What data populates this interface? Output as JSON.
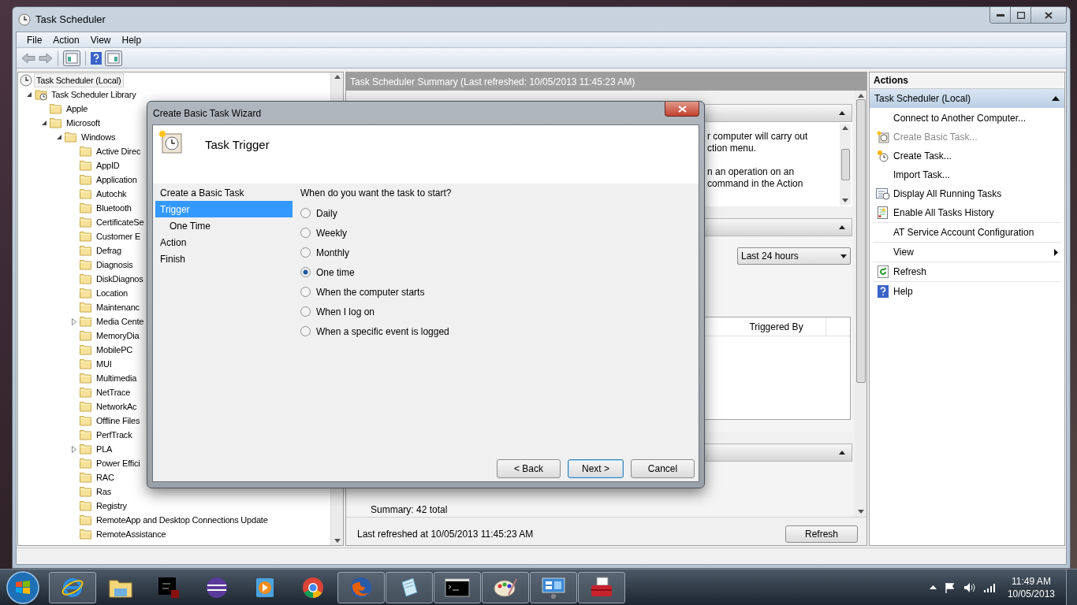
{
  "window": {
    "title": "Task Scheduler"
  },
  "menu": [
    "File",
    "Action",
    "View",
    "Help"
  ],
  "tree": [
    {
      "label": "Task Scheduler (Local)",
      "selected": true,
      "children": [
        {
          "label": "Task Scheduler Library",
          "selected": false,
          "expanded": true,
          "children": [
            {
              "label": "Apple",
              "selected": false
            },
            {
              "label": "Microsoft",
              "selected": false,
              "expanded": true,
              "children": [
                {
                  "label": "Windows",
                  "selected": false,
                  "expanded": true,
                  "children": [
                    {
                      "label": "Active Direc",
                      "selected": false
                    },
                    {
                      "label": "AppID",
                      "selected": false
                    },
                    {
                      "label": "Application",
                      "selected": false
                    },
                    {
                      "label": "Autochk",
                      "selected": false
                    },
                    {
                      "label": "Bluetooth",
                      "selected": false
                    },
                    {
                      "label": "CertificateSe",
                      "selected": false
                    },
                    {
                      "label": "Customer E",
                      "selected": false
                    },
                    {
                      "label": "Defrag",
                      "selected": false
                    },
                    {
                      "label": "Diagnosis",
                      "selected": false
                    },
                    {
                      "label": "DiskDiagnos",
                      "selected": false
                    },
                    {
                      "label": "Location",
                      "selected": false
                    },
                    {
                      "label": "Maintenanc",
                      "selected": false
                    },
                    {
                      "label": "Media Cente",
                      "selected": false,
                      "expanded": false
                    },
                    {
                      "label": "MemoryDia",
                      "selected": false
                    },
                    {
                      "label": "MobilePC",
                      "selected": false
                    },
                    {
                      "label": "MUI",
                      "selected": false
                    },
                    {
                      "label": "Multimedia",
                      "selected": false
                    },
                    {
                      "label": "NetTrace",
                      "selected": false
                    },
                    {
                      "label": "NetworkAc",
                      "selected": false
                    },
                    {
                      "label": "Offline Files",
                      "selected": false
                    },
                    {
                      "label": "PerfTrack",
                      "selected": false
                    },
                    {
                      "label": "PLA",
                      "selected": false,
                      "expanded": false
                    },
                    {
                      "label": "Power Effici",
                      "selected": false
                    },
                    {
                      "label": "RAC",
                      "selected": false
                    },
                    {
                      "label": "Ras",
                      "selected": false
                    },
                    {
                      "label": "Registry",
                      "selected": false
                    },
                    {
                      "label": "RemoteApp and Desktop Connections Update",
                      "selected": false
                    },
                    {
                      "label": "RemoteAssistance",
                      "selected": false
                    }
                  ]
                }
              ]
            }
          ]
        }
      ]
    }
  ],
  "summary": {
    "title": "Task Scheduler Summary (Last refreshed: 10/05/2013 11:45:23 AM)",
    "sections": [
      {
        "expanded": true
      },
      {
        "expanded": true
      },
      {
        "expanded": true
      }
    ],
    "overview_lines": [
      "r computer will carry out",
      "ction menu.",
      "n an operation on an",
      "command in the Action"
    ],
    "status_filter": "Last 24 hours",
    "table_columns": [
      "Triggered By"
    ],
    "summary_text": "Summary: 42 total",
    "last_refreshed": "Last refreshed at 10/05/2013 11:45:23 AM",
    "refresh_button": "Refresh"
  },
  "actions": {
    "title": "Actions",
    "group": {
      "label": "Task Scheduler (Local)",
      "expanded": true
    },
    "groups": [
      [
        {
          "label": "Connect to Another Computer...",
          "disabled": false,
          "submenu": false
        },
        {
          "label": "Create Basic Task...",
          "disabled": true,
          "submenu": false
        },
        {
          "label": "Create Task...",
          "disabled": false,
          "submenu": false
        },
        {
          "label": "Import Task...",
          "disabled": false,
          "submenu": false
        },
        {
          "label": "Display All Running Tasks",
          "disabled": false,
          "submenu": false
        },
        {
          "label": "Enable All Tasks History",
          "disabled": false,
          "submenu": false
        }
      ],
      [
        {
          "label": "AT Service Account Configuration",
          "disabled": false,
          "submenu": false
        }
      ],
      [
        {
          "label": "View",
          "disabled": false,
          "submenu": true
        }
      ],
      [
        {
          "label": "Refresh",
          "disabled": false,
          "submenu": false
        }
      ],
      [
        {
          "label": "Help",
          "disabled": false,
          "submenu": false
        }
      ]
    ]
  },
  "wizard": {
    "title": "Create Basic Task Wizard",
    "heading": "Task Trigger",
    "steps": [
      {
        "label": "Create a Basic Task",
        "selected": false
      },
      {
        "label": "Trigger",
        "selected": true,
        "children": [
          {
            "label": "One Time",
            "selected": false
          }
        ]
      },
      {
        "label": "Action",
        "selected": false
      },
      {
        "label": "Finish",
        "selected": false
      }
    ],
    "question": "When do you want the task to start?",
    "options": [
      {
        "label": "Daily",
        "selected": false
      },
      {
        "label": "Weekly",
        "selected": false
      },
      {
        "label": "Monthly",
        "selected": false
      },
      {
        "label": "One time",
        "selected": true
      },
      {
        "label": "When the computer starts",
        "selected": false
      },
      {
        "label": "When I log on",
        "selected": false
      },
      {
        "label": "When a specific event is logged",
        "selected": false
      }
    ],
    "buttons": [
      {
        "label": "< Back",
        "default": false
      },
      {
        "label": "Next >",
        "default": true
      },
      {
        "label": "Cancel",
        "default": false
      }
    ]
  },
  "taskbar": {
    "apps": [
      {
        "running": true
      },
      {
        "running": false
      },
      {
        "running": false
      },
      {
        "running": false
      },
      {
        "running": false
      },
      {
        "running": false
      },
      {
        "running": true
      },
      {
        "running": true
      },
      {
        "running": true
      },
      {
        "running": true
      },
      {
        "running": true
      },
      {
        "running": true
      }
    ],
    "clock": {
      "time": "11:49 AM",
      "date": "10/05/2013"
    }
  }
}
